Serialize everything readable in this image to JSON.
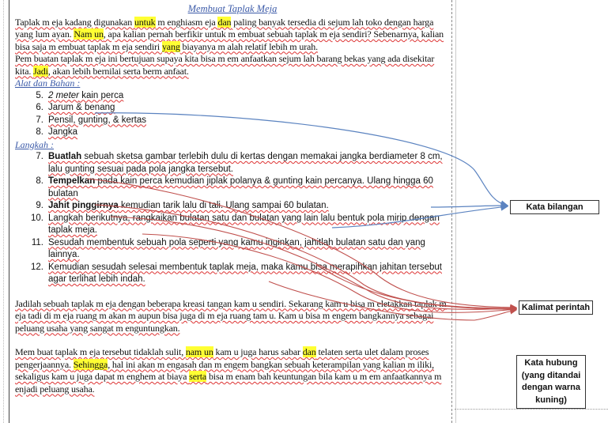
{
  "doc": {
    "title": "Membuat Taplak Meja",
    "intro1_a": "Taplak m eja kadang digunakan ",
    "intro1_hl1": "untuk",
    "intro1_b": " m enghiasm eja ",
    "intro1_hl2": "dan",
    "intro1_c": " paling banyak tersedia di sejum lah toko dengan harga yang lum ayan. ",
    "intro1_hl3": "Nam un",
    "intro1_d": ", apa kalian pernah berfikir untuk m embuat sebuah taplak m eja sendiri? Sebenarnya, kalian bisa saja m embuat taplak m eja sendiri ",
    "intro1_hl4": "yang",
    "intro1_e": " biayanya m alah relatif lebih m urah.",
    "intro2_a": "Pem buatan taplak m eja ini bertujuan supaya kita bisa m em anfaatkan sejum lah barang bekas yang ada disekitar kita. ",
    "intro2_hl": "Jadi",
    "intro2_b": ", akan lebih bernilai serta berm anfaat.",
    "materials_heading": "Alat dan Bahan :",
    "materials": [
      {
        "num": "5.",
        "text_a": "2 meter",
        "text_b": " kain perca"
      },
      {
        "num": "6.",
        "text_a": "",
        "text_b": "Jarum & benang"
      },
      {
        "num": "7.",
        "text_a": "",
        "text_b": "Pensil, gunting, & kertas"
      },
      {
        "num": "8.",
        "text_a": "",
        "text_b": "Jangka"
      }
    ],
    "steps_heading": "Langkah :",
    "steps": [
      {
        "num": "7.",
        "bold": "Buatlah",
        "rest": " sebuah sketsa gambar terlebih dulu di kertas dengan memakai jangka berdiameter 8 cm, lalu gunting sesuai pada pola jangka tersebut."
      },
      {
        "num": "8.",
        "bold": "Tempelkan",
        "rest": " pada kain perca kemudian jiplak polanya & gunting kain percanya. Ulang hingga 60 bulatan"
      },
      {
        "num": "9.",
        "bold": "Jahit pinggirnya",
        "rest": " kemudian tarik lalu di tali. Ulang sampai 60 bulatan."
      },
      {
        "num": "10.",
        "bold": "",
        "rest": "Langkah berikutnya, rangkaikan bulatan satu dan bulatan yang lain lalu bentuk pola mirip dengan taplak meja."
      },
      {
        "num": "11.",
        "bold": "",
        "rest": "Sesudah membentuk sebuah pola seperti yang kamu inginkan, jahitlah bulatan satu dan yang lainnya."
      },
      {
        "num": "12.",
        "bold": "",
        "rest": "Kemudian sesudah selesai membentuk taplak meja, maka kamu bisa merapihkan jahitan tersebut agar terlihat lebih indah."
      }
    ],
    "outro1": "Jadilah sebuah taplak m eja dengan beberapa kreasi tangan kam u sendiri. Sekarang kam u bisa m eletakkan taplak m eja tadi di m eja ruang m akan m aupun bisa juga di m eja ruang tam u. Kam u bisa m engem bangkannya sebagai peluang usaha yang sangat m enguntungkan.",
    "outro2_a": "Mem buat taplak m eja tersebut tidaklah sulit, ",
    "outro2_hl1": "nam un",
    "outro2_b": " kam u juga harus sabar ",
    "outro2_hl2": "dan",
    "outro2_c": " telaten serta ulet dalam proses pengerjaannya. ",
    "outro2_hl3": "Sehingga",
    "outro2_d": ", hal ini akan m engasah dan m engem bangkan sebuah keterampilan yang kalian m iliki, sekaligus kam u juga dapat m enghem at biaya ",
    "outro2_hl4": "serta",
    "outro2_e": " bisa m enam bah keuntungan bila kam u m em anfaatkannya m enjadi peluang usaha."
  },
  "labels": {
    "kata_bilangan": "Kata bilangan",
    "kalimat_perintah": "Kalimat perintah",
    "kata_hubung": "Kata hubung (yang ditandai dengan warna kuning)"
  },
  "colors": {
    "highlight": "#ffff33",
    "blue_arrow": "#5b83c0",
    "red_arrow": "#c0504d",
    "heading": "#3b5aa8"
  }
}
